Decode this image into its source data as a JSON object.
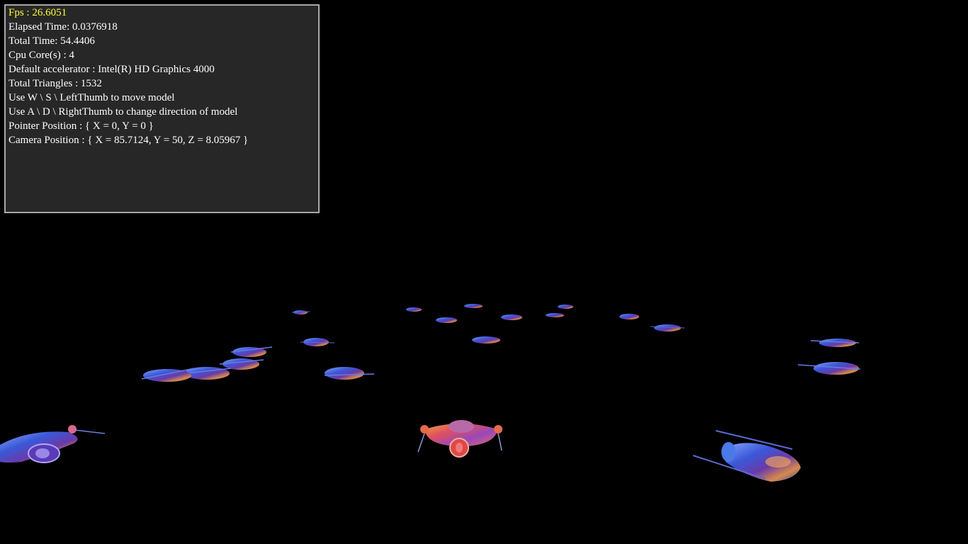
{
  "stats": {
    "fps": "Fps : 26.6051",
    "elapsed_time": "Elapsed Time: 0.0376918",
    "total_time": "Total Time: 54.4406",
    "cpu_cores": "Cpu Core(s) : 4",
    "default_accelerator": "Default accelerator : Intel(R) HD Graphics 4000",
    "total_triangles": "Total Triangles : 1532",
    "move_hint": "Use W \\ S \\ LeftThumb to move model",
    "direction_hint": "Use A \\ D \\ RightThumb to change direction of model",
    "pointer_position": "Pointer Position : { X = 0, Y = 0 }",
    "camera_position": "Camera Position : { X = 85.7124, Y = 50, Z = 8.05967 }"
  },
  "colors": {
    "background": "#000000",
    "panel_background": "#272727",
    "panel_border": "#a8a8a8",
    "text": "#ffffff",
    "fps_text": "#ffff3c",
    "player_ship": "#e0605a",
    "enemy_ship": "#4a6ad8"
  },
  "scene": {
    "player_ship": "red-spaceship",
    "fleet_ship": "blue-spaceship"
  }
}
